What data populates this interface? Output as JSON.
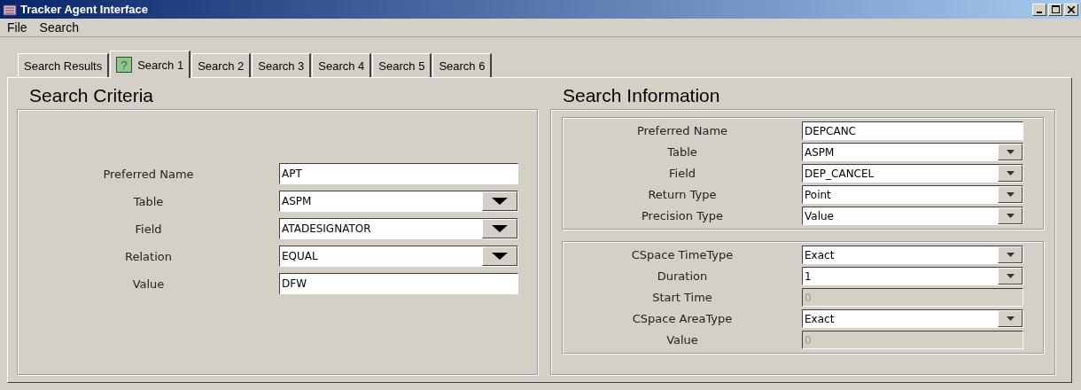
{
  "window": {
    "title": "Tracker Agent Interface"
  },
  "menu": [
    "File",
    "Search"
  ],
  "tabs": [
    {
      "label": "Search Results",
      "selected": false
    },
    {
      "label": "Search 1",
      "selected": true,
      "glyph": "?"
    },
    {
      "label": "Search 2",
      "selected": false
    },
    {
      "label": "Search 3",
      "selected": false
    },
    {
      "label": "Search 4",
      "selected": false
    },
    {
      "label": "Search 5",
      "selected": false
    },
    {
      "label": "Search 6",
      "selected": false
    }
  ],
  "search_criteria": {
    "title": "Search Criteria",
    "fields": [
      {
        "label": "Preferred Name",
        "kind": "text",
        "value": "APT"
      },
      {
        "label": "Table",
        "kind": "combo",
        "value": "ASPM"
      },
      {
        "label": "Field",
        "kind": "combo",
        "value": "ATADESIGNATOR"
      },
      {
        "label": "Relation",
        "kind": "combo",
        "value": "EQUAL"
      },
      {
        "label": "Value",
        "kind": "text",
        "value": "DFW"
      }
    ]
  },
  "search_information": {
    "title": "Search Information",
    "groups": [
      {
        "fields": [
          {
            "label": "Preferred Name",
            "kind": "text",
            "value": "DEPCANC",
            "disabled": false
          },
          {
            "label": "Table",
            "kind": "combo",
            "value": "ASPM",
            "disabled": false
          },
          {
            "label": "Field",
            "kind": "combo",
            "value": "DEP_CANCEL",
            "disabled": false
          },
          {
            "label": "Return Type",
            "kind": "combo",
            "value": "Point",
            "disabled": false
          },
          {
            "label": "Precision Type",
            "kind": "combo",
            "value": "Value",
            "disabled": false
          }
        ]
      },
      {
        "fields": [
          {
            "label": "CSpace TimeType",
            "kind": "combo",
            "value": "Exact",
            "disabled": false
          },
          {
            "label": "Duration",
            "kind": "combo",
            "value": "1",
            "disabled": false
          },
          {
            "label": "Start Time",
            "kind": "text",
            "value": "0",
            "disabled": true
          },
          {
            "label": "CSpace AreaType",
            "kind": "combo",
            "value": "Exact",
            "disabled": false
          },
          {
            "label": "Value",
            "kind": "text",
            "value": "0",
            "disabled": true
          }
        ]
      }
    ]
  }
}
